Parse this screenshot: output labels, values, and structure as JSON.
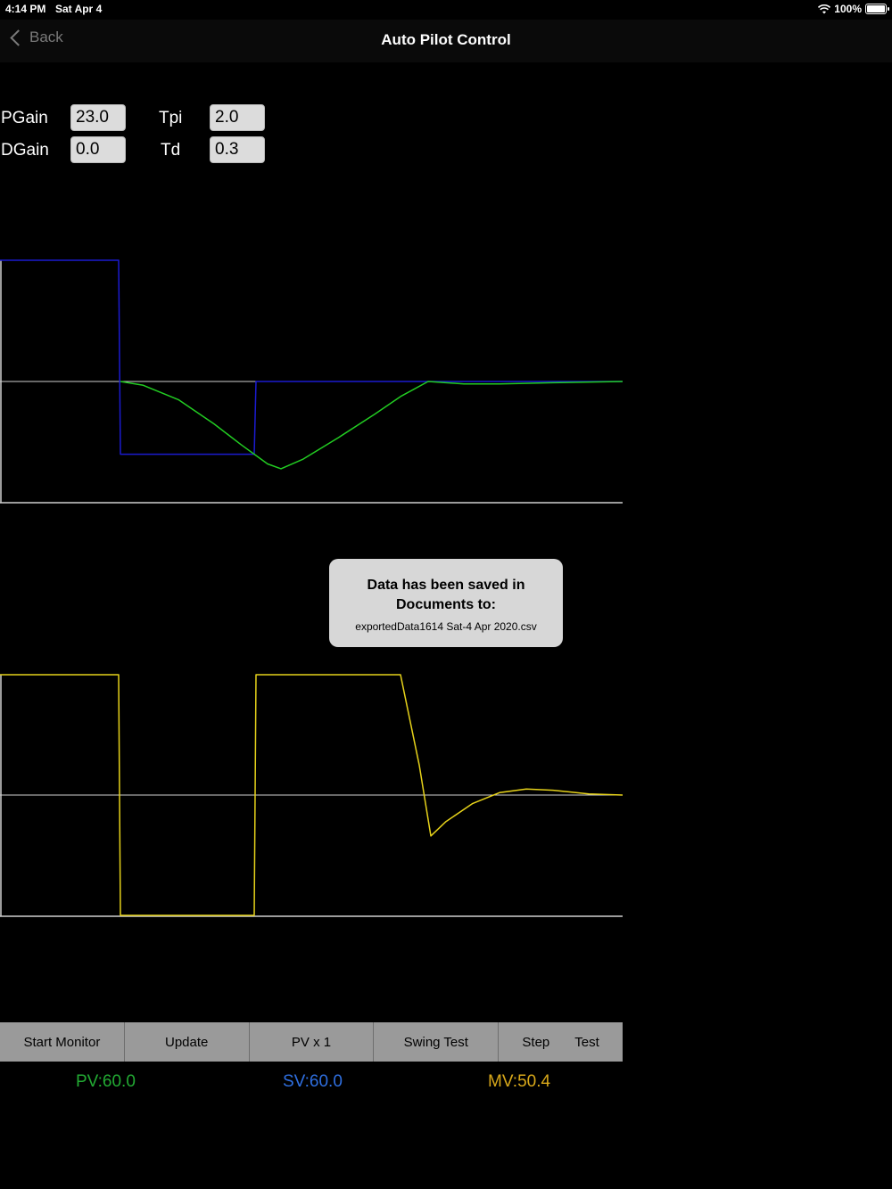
{
  "status_bar": {
    "time": "4:14 PM",
    "date": "Sat Apr 4",
    "battery": "100%"
  },
  "nav": {
    "back_label": "Back",
    "title": "Auto Pilot Control"
  },
  "params": {
    "pgain_label": "PGain",
    "pgain_value": "23.0",
    "tpi_label": "Tpi",
    "tpi_value": "2.0",
    "dgain_label": "DGain",
    "dgain_value": "0.0",
    "td_label": "Td",
    "td_value": "0.3"
  },
  "chart_data": [
    {
      "type": "line",
      "title": "",
      "grid": false,
      "series": [
        {
          "color": "#1b1bd0",
          "points": [
            [
              0,
              1
            ],
            [
              133,
              1
            ],
            [
              135,
              -0.6
            ],
            [
              285,
              -0.6
            ],
            [
              287,
              0
            ],
            [
              698,
              0
            ]
          ]
        },
        {
          "color": "#22cc22",
          "points": [
            [
              135,
              0
            ],
            [
              160,
              -0.03
            ],
            [
              200,
              -0.15
            ],
            [
              240,
              -0.35
            ],
            [
              270,
              -0.52
            ],
            [
              300,
              -0.68
            ],
            [
              315,
              -0.72
            ],
            [
              340,
              -0.64
            ],
            [
              380,
              -0.46
            ],
            [
              420,
              -0.27
            ],
            [
              450,
              -0.12
            ],
            [
              480,
              0
            ],
            [
              520,
              -0.02
            ],
            [
              560,
              -0.02
            ],
            [
              620,
              -0.01
            ],
            [
              698,
              0
            ]
          ]
        }
      ]
    },
    {
      "type": "line",
      "title": "",
      "grid": false,
      "series": [
        {
          "color": "#e6d21a",
          "points": [
            [
              0,
              1
            ],
            [
              133,
              1
            ],
            [
              135,
              -1
            ],
            [
              285,
              -1
            ],
            [
              287,
              1
            ],
            [
              449,
              1
            ],
            [
              470,
              0.25
            ],
            [
              483,
              -0.34
            ],
            [
              500,
              -0.22
            ],
            [
              530,
              -0.07
            ],
            [
              560,
              0.02
            ],
            [
              590,
              0.05
            ],
            [
              620,
              0.04
            ],
            [
              660,
              0.01
            ],
            [
              698,
              0
            ]
          ]
        }
      ]
    }
  ],
  "toast": {
    "title": "Data has been saved in Documents to:",
    "file": "exportedData1614 Sat-4 Apr 2020.csv"
  },
  "toolbar": {
    "start_monitor": "Start Monitor",
    "update": "Update",
    "pv_scale": "PV x 1",
    "swing_test": "Swing Test",
    "step": "Step",
    "test": "Test"
  },
  "readouts": {
    "pv": "PV:60.0",
    "pv_color": "#22aa33",
    "sv": "SV:60.0",
    "sv_color": "#2f6fe0",
    "mv": "MV:50.4",
    "mv_color": "#d8a81a"
  }
}
